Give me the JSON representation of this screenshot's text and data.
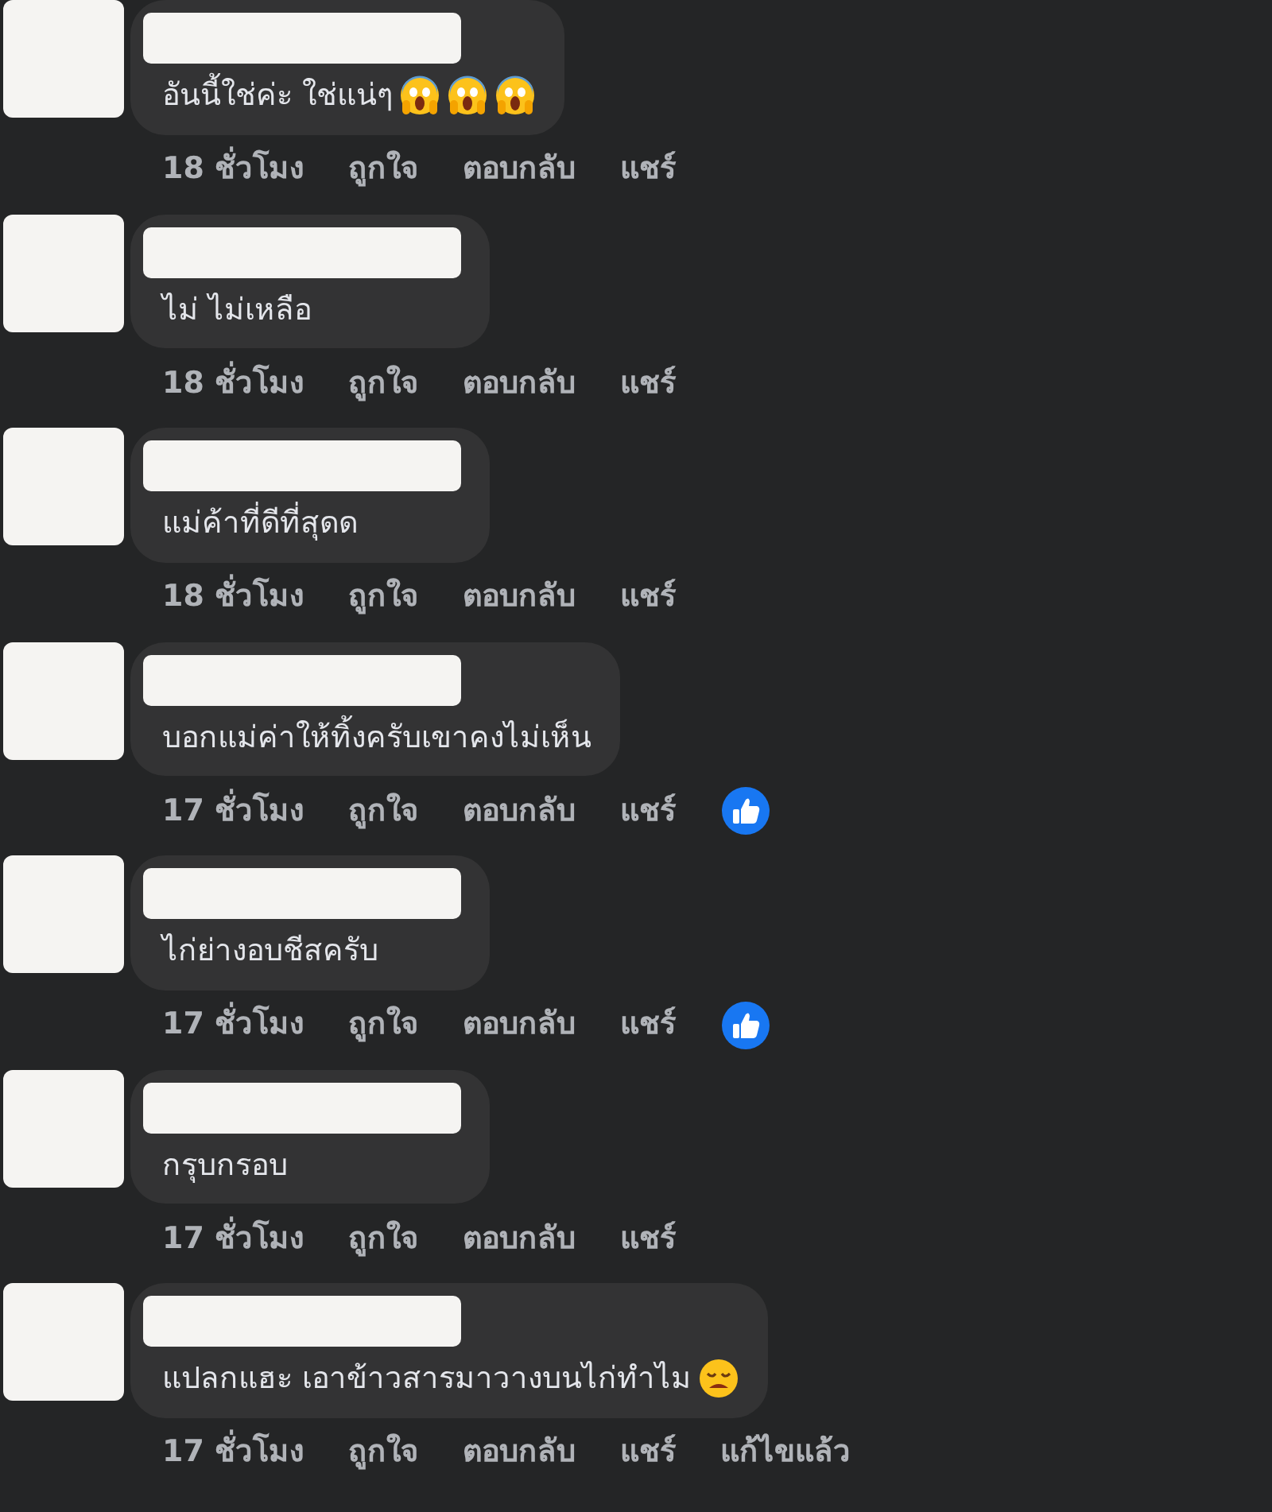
{
  "comments": [
    {
      "text": "อันนี้ใช่ค่ะ ใช่แน่ๆ",
      "emoji": [
        {
          "kind": "scream"
        },
        {
          "kind": "scream"
        },
        {
          "kind": "scream"
        }
      ],
      "time": "18 ชั่วโมง",
      "like": "ถูกใจ",
      "reply": "ตอบกลับ",
      "share": "แชร์",
      "liked": false
    },
    {
      "text": "ไม่ ไม่เหลือ",
      "time": "18 ชั่วโมง",
      "like": "ถูกใจ",
      "reply": "ตอบกลับ",
      "share": "แชร์",
      "liked": false
    },
    {
      "text": "แม่ค้าที่ดีที่สุดด",
      "time": "18 ชั่วโมง",
      "like": "ถูกใจ",
      "reply": "ตอบกลับ",
      "share": "แชร์",
      "liked": false
    },
    {
      "text": "บอกแม่ค่าให้ทิ้งครับเขาคงไม่เห็น",
      "time": "17 ชั่วโมง",
      "like": "ถูกใจ",
      "reply": "ตอบกลับ",
      "share": "แชร์",
      "liked": true
    },
    {
      "text": "ไก่ย่างอบชีสครับ",
      "time": "17 ชั่วโมง",
      "like": "ถูกใจ",
      "reply": "ตอบกลับ",
      "share": "แชร์",
      "liked": true
    },
    {
      "text": "กรุบกรอบ",
      "time": "17 ชั่วโมง",
      "like": "ถูกใจ",
      "reply": "ตอบกลับ",
      "share": "แชร์",
      "liked": false
    },
    {
      "text": "แปลกแฮะ เอาข้าวสารมาวางบนไก่ทำไม",
      "emoji": [
        {
          "kind": "weary"
        }
      ],
      "time": "17 ชั่วโมง",
      "like": "ถูกใจ",
      "reply": "ตอบกลับ",
      "share": "แชร์",
      "liked": false,
      "edited": "แก้ไขแล้ว"
    }
  ]
}
